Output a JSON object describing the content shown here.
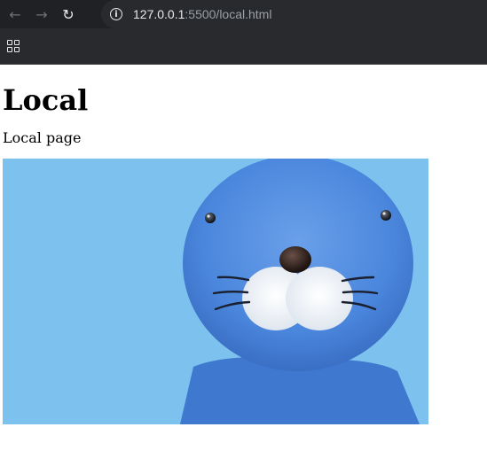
{
  "browser": {
    "url_host": "127.0.0.1",
    "url_rest": ":5500/local.html"
  },
  "page": {
    "heading": "Local",
    "paragraph": "Local page"
  },
  "image": {
    "subject": "blue seal illustration",
    "background_color": "#7dc2ef",
    "body_color": "#4a86dc",
    "muzzle_color": "#f4f6f8",
    "nose_color": "#2b1d18"
  }
}
